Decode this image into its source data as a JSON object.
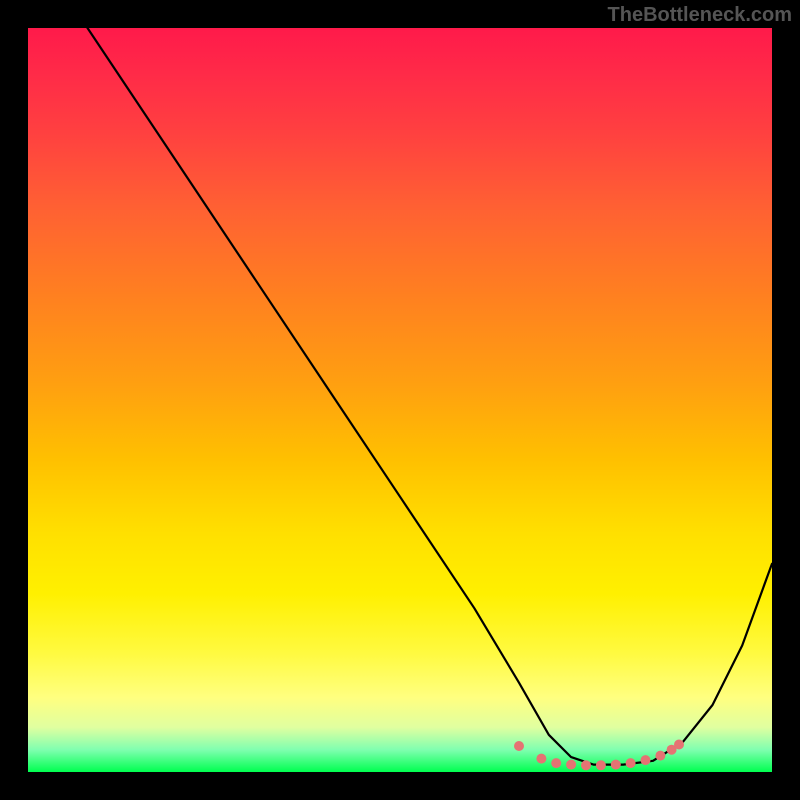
{
  "watermark": "TheBottleneck.com",
  "chart_data": {
    "type": "line",
    "title": "",
    "xlabel": "",
    "ylabel": "",
    "xlim": [
      0,
      100
    ],
    "ylim": [
      0,
      100
    ],
    "series": [
      {
        "name": "curve",
        "x": [
          0,
          8,
          20,
          30,
          40,
          50,
          60,
          66,
          70,
          73,
          76,
          80,
          84,
          88,
          92,
          96,
          100
        ],
        "y": [
          112,
          100,
          82,
          67,
          52,
          37,
          22,
          12,
          5,
          2,
          1,
          1,
          1.5,
          4,
          9,
          17,
          28
        ]
      }
    ],
    "gradient_stops": [
      {
        "pos": 0,
        "color": "#ff1a4a"
      },
      {
        "pos": 50,
        "color": "#ffc000"
      },
      {
        "pos": 90,
        "color": "#ffff80"
      },
      {
        "pos": 100,
        "color": "#00ff50"
      }
    ],
    "bottom_dots": {
      "color": "#e57373",
      "points": [
        {
          "x": 66,
          "y": 3.5
        },
        {
          "x": 69,
          "y": 1.8
        },
        {
          "x": 71,
          "y": 1.2
        },
        {
          "x": 73,
          "y": 1.0
        },
        {
          "x": 75,
          "y": 0.9
        },
        {
          "x": 77,
          "y": 0.9
        },
        {
          "x": 79,
          "y": 1.0
        },
        {
          "x": 81,
          "y": 1.2
        },
        {
          "x": 83,
          "y": 1.6
        },
        {
          "x": 85,
          "y": 2.2
        },
        {
          "x": 86.5,
          "y": 3.0
        },
        {
          "x": 87.5,
          "y": 3.7
        }
      ]
    }
  }
}
